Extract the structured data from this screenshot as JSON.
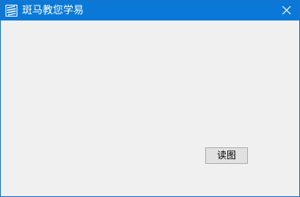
{
  "window": {
    "title": "斑马教您学易",
    "app_icon": "zebra-stripes-icon",
    "close_icon": "close-icon",
    "accent_color": "#0a78d7"
  },
  "main": {
    "read_button_label": "读图"
  }
}
